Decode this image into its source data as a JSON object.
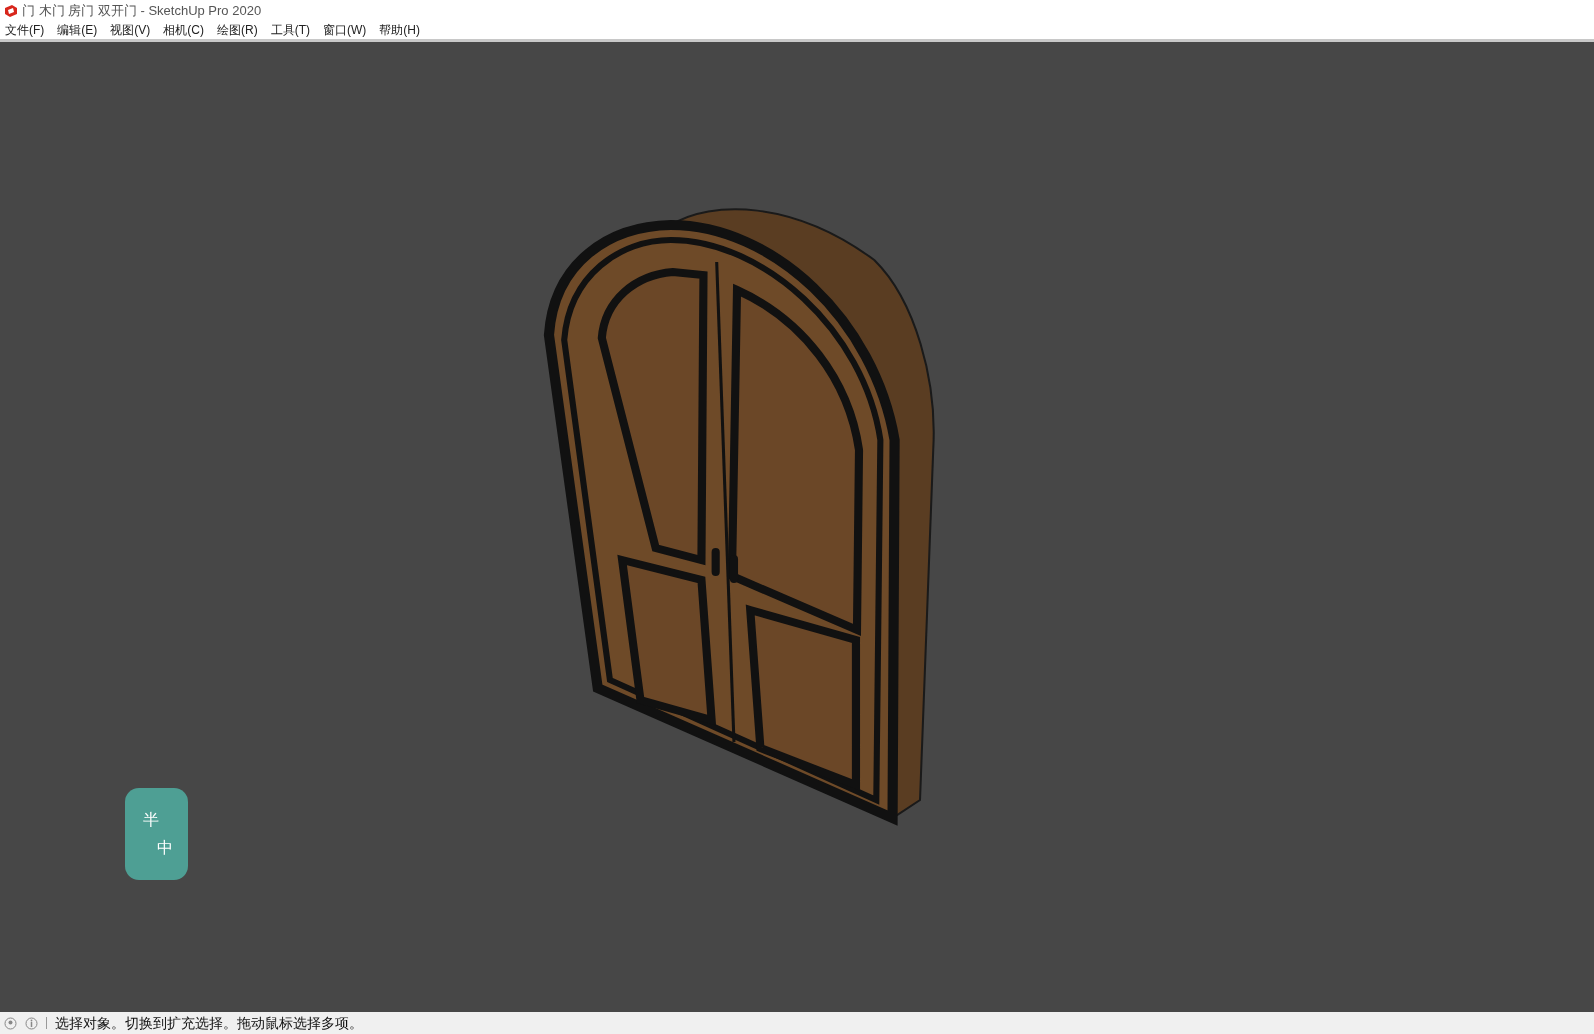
{
  "window": {
    "title": "门 木门 房门 双开门 - SketchUp Pro 2020"
  },
  "menu": [
    "文件(F)",
    "编辑(E)",
    "视图(V)",
    "相机(C)",
    "绘图(R)",
    "工具(T)",
    "窗口(W)",
    "帮助(H)"
  ],
  "ime_indicator": {
    "width_mode": "半",
    "language": "中"
  },
  "status_bar": {
    "message": "选择对象。切换到扩充选择。拖动鼠标选择多项。"
  }
}
